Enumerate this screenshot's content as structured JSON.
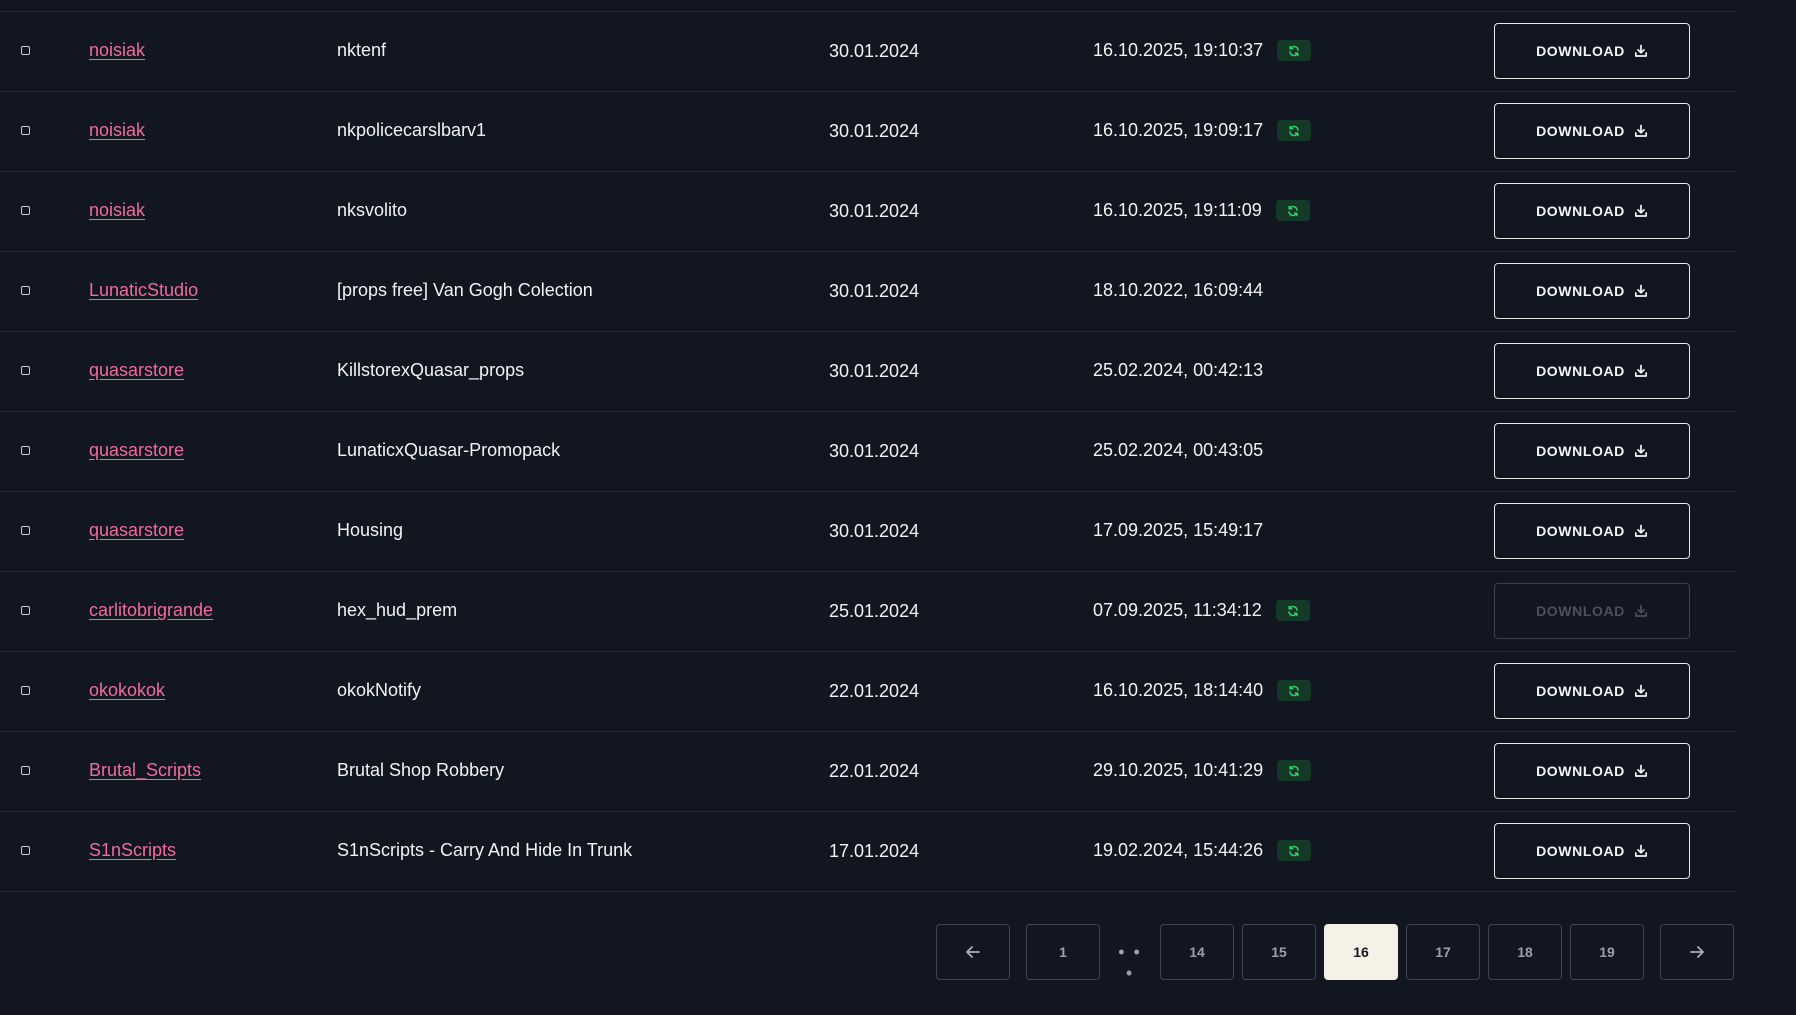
{
  "table": {
    "rows": [
      {
        "seller": "noisiak",
        "name": "nktenf",
        "date": "30.01.2024",
        "updated": "16.10.2025, 19:10:37",
        "synced": true,
        "download_label": "DOWNLOAD",
        "download_enabled": true
      },
      {
        "seller": "noisiak",
        "name": "nkpolicecarslbarv1",
        "date": "30.01.2024",
        "updated": "16.10.2025, 19:09:17",
        "synced": true,
        "download_label": "DOWNLOAD",
        "download_enabled": true
      },
      {
        "seller": "noisiak",
        "name": "nksvolito",
        "date": "30.01.2024",
        "updated": "16.10.2025, 19:11:09",
        "synced": true,
        "download_label": "DOWNLOAD",
        "download_enabled": true
      },
      {
        "seller": "LunaticStudio",
        "name": "[props free] Van Gogh Colection",
        "date": "30.01.2024",
        "updated": "18.10.2022, 16:09:44",
        "synced": false,
        "download_label": "DOWNLOAD",
        "download_enabled": true
      },
      {
        "seller": "quasarstore",
        "name": "KillstorexQuasar_props",
        "date": "30.01.2024",
        "updated": "25.02.2024, 00:42:13",
        "synced": false,
        "download_label": "DOWNLOAD",
        "download_enabled": true
      },
      {
        "seller": "quasarstore",
        "name": "LunaticxQuasar-Promopack",
        "date": "30.01.2024",
        "updated": "25.02.2024, 00:43:05",
        "synced": false,
        "download_label": "DOWNLOAD",
        "download_enabled": true
      },
      {
        "seller": "quasarstore",
        "name": "Housing",
        "date": "30.01.2024",
        "updated": "17.09.2025, 15:49:17",
        "synced": false,
        "download_label": "DOWNLOAD",
        "download_enabled": true
      },
      {
        "seller": "carlitobrigrande",
        "name": "hex_hud_prem",
        "date": "25.01.2024",
        "updated": "07.09.2025, 11:34:12",
        "synced": true,
        "download_label": "DOWNLOAD",
        "download_enabled": false
      },
      {
        "seller": "okokokok",
        "name": "okokNotify",
        "date": "22.01.2024",
        "updated": "16.10.2025, 18:14:40",
        "synced": true,
        "download_label": "DOWNLOAD",
        "download_enabled": true
      },
      {
        "seller": "Brutal_Scripts",
        "name": "Brutal Shop Robbery",
        "date": "22.01.2024",
        "updated": "29.10.2025, 10:41:29",
        "synced": true,
        "download_label": "DOWNLOAD",
        "download_enabled": true
      },
      {
        "seller": "S1nScripts",
        "name": "S1nScripts - Carry And Hide In Trunk",
        "date": "17.01.2024",
        "updated": "19.02.2024, 15:44:26",
        "synced": true,
        "download_label": "DOWNLOAD",
        "download_enabled": true
      }
    ]
  },
  "pagination": {
    "prev_icon": "arrow-left-icon",
    "next_icon": "arrow-right-icon",
    "first": "1",
    "ellipsis": "• • •",
    "pages": [
      "14",
      "15",
      "16",
      "17",
      "18",
      "19"
    ],
    "current": "16"
  },
  "colors": {
    "background": "#121620",
    "seller_link": "#f06aa0",
    "sync_badge_bg": "#163826",
    "sync_icon": "#2fd36a",
    "active_page_bg": "#f4f1e6"
  }
}
